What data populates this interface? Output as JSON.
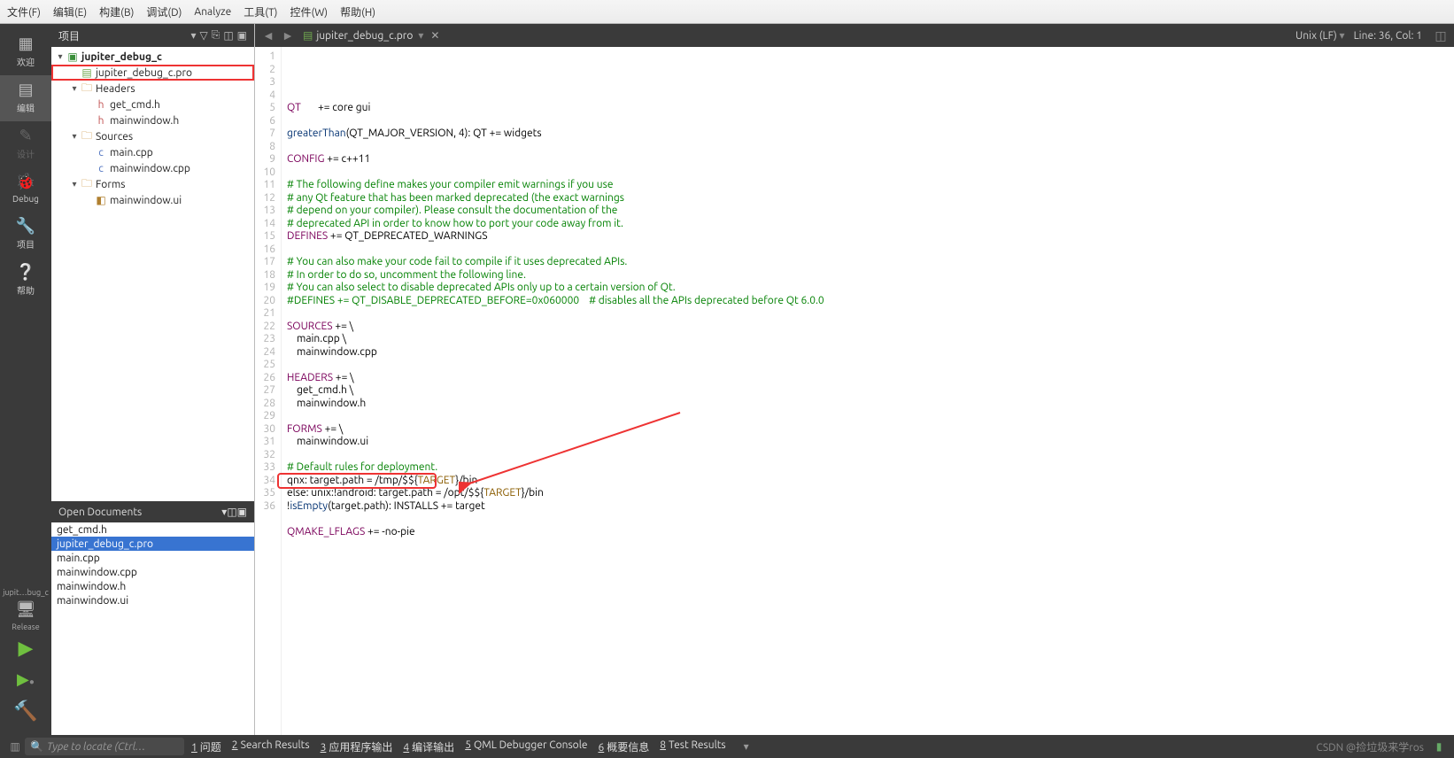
{
  "menu": {
    "file": "文件(F)",
    "edit": "编辑(E)",
    "build": "构建(B)",
    "debug": "调试(D)",
    "analyze": "Analyze",
    "tools": "工具(T)",
    "widgets": "控件(W)",
    "help": "帮助(H)"
  },
  "activity": {
    "welcome": "欢迎",
    "edit": "编辑",
    "design": "设计",
    "debug": "Debug",
    "project": "项目",
    "help": "帮助",
    "release": "Release",
    "tab": "jupit…bug_c"
  },
  "panel": {
    "projects": "项目",
    "open_docs": "Open Documents"
  },
  "tree": {
    "root": "jupiter_debug_c",
    "pro": "jupiter_debug_c.pro",
    "headers": "Headers",
    "h1": "get_cmd.h",
    "h2": "mainwindow.h",
    "sources": "Sources",
    "s1": "main.cpp",
    "s2": "mainwindow.cpp",
    "forms": "Forms",
    "f1": "mainwindow.ui"
  },
  "open_docs": [
    "get_cmd.h",
    "jupiter_debug_c.pro",
    "main.cpp",
    "mainwindow.cpp",
    "mainwindow.h",
    "mainwindow.ui"
  ],
  "editor": {
    "file": "jupiter_debug_c.pro",
    "encoding": "Unix (LF)",
    "pos": "Line: 36, Col: 1"
  },
  "code": {
    "lines": [
      {
        "n": 1,
        "t": [
          [
            "kw",
            "QT"
          ],
          [
            "p",
            "       += core gui"
          ]
        ]
      },
      {
        "n": 2,
        "t": []
      },
      {
        "n": 3,
        "t": [
          [
            "func",
            "greaterThan"
          ],
          [
            "p",
            "(QT_MAJOR_VERSION, 4): QT += widgets"
          ]
        ]
      },
      {
        "n": 4,
        "t": []
      },
      {
        "n": 5,
        "t": [
          [
            "kw",
            "CONFIG"
          ],
          [
            "p",
            " += c++11"
          ]
        ]
      },
      {
        "n": 6,
        "t": []
      },
      {
        "n": 7,
        "t": [
          [
            "cmt",
            "# The following define makes your compiler emit warnings if you use"
          ]
        ]
      },
      {
        "n": 8,
        "t": [
          [
            "cmt",
            "# any Qt feature that has been marked deprecated (the exact warnings"
          ]
        ]
      },
      {
        "n": 9,
        "t": [
          [
            "cmt",
            "# depend on your compiler). Please consult the documentation of the"
          ]
        ]
      },
      {
        "n": 10,
        "t": [
          [
            "cmt",
            "# deprecated API in order to know how to port your code away from it."
          ]
        ]
      },
      {
        "n": 11,
        "t": [
          [
            "kw",
            "DEFINES"
          ],
          [
            "p",
            " += QT_DEPRECATED_WARNINGS"
          ]
        ]
      },
      {
        "n": 12,
        "t": []
      },
      {
        "n": 13,
        "t": [
          [
            "cmt",
            "# You can also make your code fail to compile if it uses deprecated APIs."
          ]
        ]
      },
      {
        "n": 14,
        "t": [
          [
            "cmt",
            "# In order to do so, uncomment the following line."
          ]
        ]
      },
      {
        "n": 15,
        "t": [
          [
            "cmt",
            "# You can also select to disable deprecated APIs only up to a certain version of Qt."
          ]
        ]
      },
      {
        "n": 16,
        "t": [
          [
            "cmt",
            "#DEFINES += QT_DISABLE_DEPRECATED_BEFORE=0x060000    # disables all the APIs deprecated before Qt 6.0.0"
          ]
        ]
      },
      {
        "n": 17,
        "t": []
      },
      {
        "n": 18,
        "t": [
          [
            "kw",
            "SOURCES"
          ],
          [
            "p",
            " += \\"
          ]
        ]
      },
      {
        "n": 19,
        "t": [
          [
            "p",
            "    main.cpp \\"
          ]
        ]
      },
      {
        "n": 20,
        "t": [
          [
            "p",
            "    mainwindow.cpp"
          ]
        ]
      },
      {
        "n": 21,
        "t": []
      },
      {
        "n": 22,
        "t": [
          [
            "kw",
            "HEADERS"
          ],
          [
            "p",
            " += \\"
          ]
        ]
      },
      {
        "n": 23,
        "t": [
          [
            "p",
            "    get_cmd.h \\"
          ]
        ]
      },
      {
        "n": 24,
        "t": [
          [
            "p",
            "    mainwindow.h"
          ]
        ]
      },
      {
        "n": 25,
        "t": []
      },
      {
        "n": 26,
        "t": [
          [
            "kw",
            "FORMS"
          ],
          [
            "p",
            " += \\"
          ]
        ]
      },
      {
        "n": 27,
        "t": [
          [
            "p",
            "    mainwindow.ui"
          ]
        ]
      },
      {
        "n": 28,
        "t": []
      },
      {
        "n": 29,
        "t": [
          [
            "cmt",
            "# Default rules for deployment."
          ]
        ]
      },
      {
        "n": 30,
        "t": [
          [
            "p",
            "qnx: target.path = /tmp/$${"
          ],
          [
            "target",
            "TARGET"
          ],
          [
            "p",
            "}/bin"
          ]
        ]
      },
      {
        "n": 31,
        "t": [
          [
            "p",
            "else: unix:!android: target.path = /opt/$${"
          ],
          [
            "target",
            "TARGET"
          ],
          [
            "p",
            "}/bin"
          ]
        ]
      },
      {
        "n": 32,
        "t": [
          [
            "p",
            "!"
          ],
          [
            "func",
            "isEmpty"
          ],
          [
            "p",
            "(target.path): INSTALLS += target"
          ]
        ]
      },
      {
        "n": 33,
        "t": []
      },
      {
        "n": 34,
        "t": [
          [
            "kw",
            "QMAKE_LFLAGS"
          ],
          [
            "p",
            " += -no-pie"
          ]
        ]
      },
      {
        "n": 35,
        "t": []
      },
      {
        "n": 36,
        "t": []
      }
    ]
  },
  "statusbar": {
    "locator_placeholder": "Type to locate (Ctrl…",
    "tabs": [
      {
        "num": "1",
        "label": "问题"
      },
      {
        "num": "2",
        "label": "Search Results"
      },
      {
        "num": "3",
        "label": "应用程序输出"
      },
      {
        "num": "4",
        "label": "编译输出"
      },
      {
        "num": "5",
        "label": "QML Debugger Console"
      },
      {
        "num": "6",
        "label": "概要信息"
      },
      {
        "num": "8",
        "label": "Test Results"
      }
    ],
    "watermark": "CSDN @捡垃圾来学ros"
  }
}
